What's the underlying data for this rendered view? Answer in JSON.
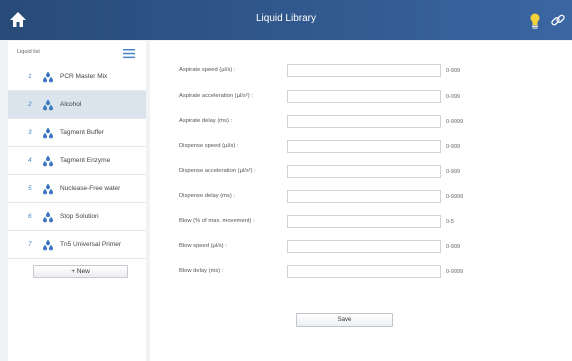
{
  "header": {
    "title": "Liquid Library",
    "home_icon": "home-icon",
    "notification_icon": "lightbulb-icon",
    "link_icon": "link-icon",
    "bar_color": "#2d5287"
  },
  "sidebar": {
    "label": "Liquid list",
    "menu_icon": "hamburger-menu-icon",
    "items": [
      {
        "num": "1",
        "label": "PCR Master Mix",
        "selected": false
      },
      {
        "num": "2",
        "label": "Alcohol",
        "selected": true
      },
      {
        "num": "3",
        "label": "Tagment Buffer",
        "selected": false
      },
      {
        "num": "4",
        "label": "Tagment Enzyme",
        "selected": false
      },
      {
        "num": "5",
        "label": "Nuclease-Free water",
        "selected": false
      },
      {
        "num": "6",
        "label": "Stop Solution",
        "selected": false
      },
      {
        "num": "7",
        "label": "Tn5 Universal Primer",
        "selected": false
      }
    ],
    "new_button": "+ New"
  },
  "form": {
    "fields": [
      {
        "label": "Aspirate speed (µl/s) :",
        "value": "",
        "range": "0-999"
      },
      {
        "label": "Aspirate acceleration (µl/s²) :",
        "value": "",
        "range": "0-999"
      },
      {
        "label": "Aspirate delay (ms) :",
        "value": "",
        "range": "0-9999"
      },
      {
        "label": "Dispense speed (µl/s) :",
        "value": "",
        "range": "0-999"
      },
      {
        "label": "Dispense acceleration (µl/s²) :",
        "value": "",
        "range": "0-999"
      },
      {
        "label": "Dispense delay (ms) :",
        "value": "",
        "range": "0-9999"
      },
      {
        "label": "Blow (% of max. movement) :",
        "value": "",
        "range": "0-5"
      },
      {
        "label": "Blow speed (µl/s) :",
        "value": "",
        "range": "0-999"
      },
      {
        "label": "Blow delay (ms) :",
        "value": "",
        "range": "0-9999"
      }
    ],
    "save_button": "Save"
  }
}
